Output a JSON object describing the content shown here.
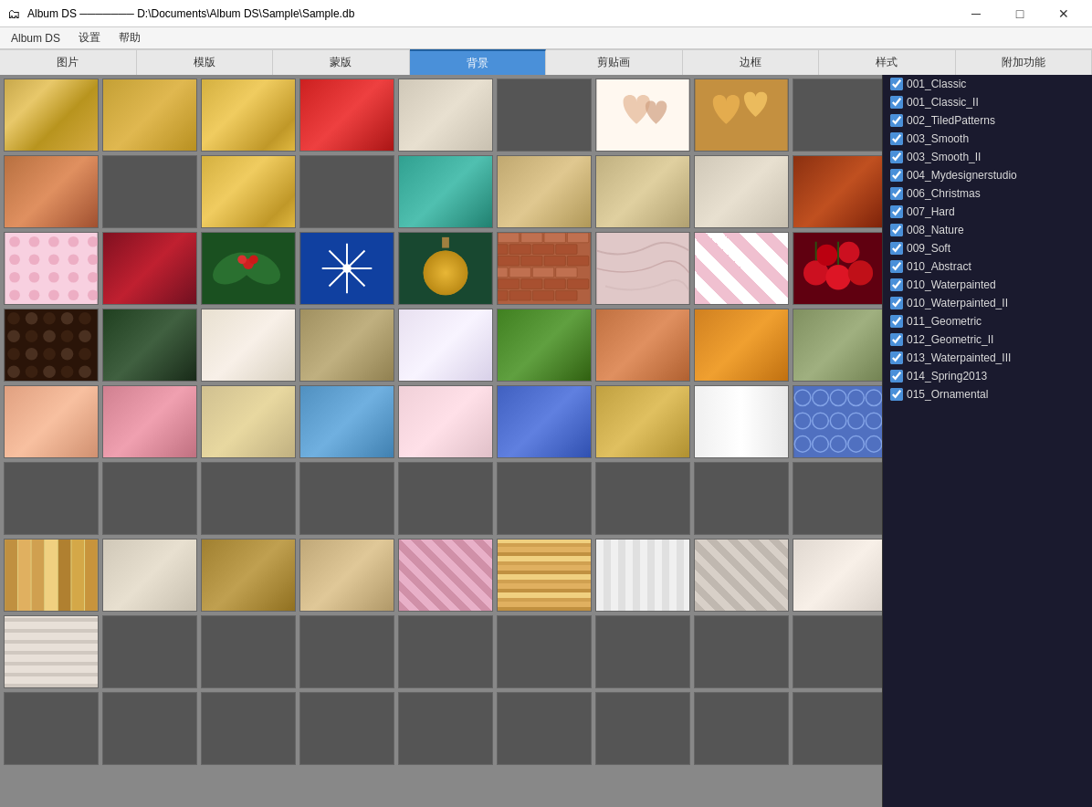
{
  "titleBar": {
    "icon": "📁",
    "title": "Album DS ─────── D:\\Documents\\Album DS\\Sample\\Sample.db",
    "minimizeLabel": "─",
    "maximizeLabel": "□",
    "closeLabel": "✕"
  },
  "menuBar": {
    "items": [
      "Album DS",
      "设置",
      "帮助"
    ]
  },
  "tabs": [
    {
      "label": "图片",
      "active": false
    },
    {
      "label": "模版",
      "active": false
    },
    {
      "label": "蒙版",
      "active": false
    },
    {
      "label": "背景",
      "active": true
    },
    {
      "label": "剪贴画",
      "active": false
    },
    {
      "label": "边框",
      "active": false
    },
    {
      "label": "样式",
      "active": false
    },
    {
      "label": "附加功能",
      "active": false
    }
  ],
  "sidebar": {
    "items": [
      {
        "id": "001_Classic",
        "label": "001_Classic",
        "checked": true
      },
      {
        "id": "001_Classic_II",
        "label": "001_Classic_II",
        "checked": true
      },
      {
        "id": "002_TiledPatterns",
        "label": "002_TiledPatterns",
        "checked": true
      },
      {
        "id": "003_Smooth",
        "label": "003_Smooth",
        "checked": true
      },
      {
        "id": "003_Smooth_II",
        "label": "003_Smooth_II",
        "checked": true
      },
      {
        "id": "004_Mydesignerstudio",
        "label": "004_Mydesignerstudio",
        "checked": true
      },
      {
        "id": "006_Christmas",
        "label": "006_Christmas",
        "checked": true
      },
      {
        "id": "007_Hard",
        "label": "007_Hard",
        "checked": true
      },
      {
        "id": "008_Nature",
        "label": "008_Nature",
        "checked": true
      },
      {
        "id": "009_Soft",
        "label": "009_Soft",
        "checked": true
      },
      {
        "id": "010_Abstract",
        "label": "010_Abstract",
        "checked": true
      },
      {
        "id": "010_Waterpainted",
        "label": "010_Waterpainted",
        "checked": true
      },
      {
        "id": "010_Waterpainted_II",
        "label": "010_Waterpainted_II",
        "checked": true
      },
      {
        "id": "011_Geometric",
        "label": "011_Geometric",
        "checked": true
      },
      {
        "id": "012_Geometric_II",
        "label": "012_Geometric_II",
        "checked": true
      },
      {
        "id": "013_Waterpainted_III",
        "label": "013_Waterpainted_III",
        "checked": true
      },
      {
        "id": "014_Spring2013",
        "label": "014_Spring2013",
        "checked": true
      },
      {
        "id": "015_Ornamental",
        "label": "015_Ornamental",
        "checked": true
      }
    ]
  },
  "thumbnails": [
    {
      "class": "tex-gold",
      "row": 1,
      "col": 1
    },
    {
      "class": "tex-gold2",
      "row": 1,
      "col": 2
    },
    {
      "class": "tex-gold3",
      "row": 1,
      "col": 3
    },
    {
      "class": "tex-red",
      "row": 1,
      "col": 4
    },
    {
      "class": "tex-gray-light",
      "row": 1,
      "col": 5
    },
    {
      "class": "",
      "row": 1,
      "col": 6
    },
    {
      "class": "tex-hearts",
      "row": 1,
      "col": 7
    },
    {
      "class": "tex-hearts-dark",
      "row": 1,
      "col": 8
    },
    {
      "class": "",
      "row": 1,
      "col": 9
    },
    {
      "class": "tex-copper",
      "row": 2,
      "col": 1
    },
    {
      "class": "",
      "row": 2,
      "col": 2
    },
    {
      "class": "tex-gold3",
      "row": 2,
      "col": 3
    },
    {
      "class": "",
      "row": 2,
      "col": 4
    },
    {
      "class": "tex-teal",
      "row": 2,
      "col": 5
    },
    {
      "class": "tex-tan",
      "row": 2,
      "col": 6
    },
    {
      "class": "tex-antique",
      "row": 2,
      "col": 7
    },
    {
      "class": "tex-gray-light",
      "row": 2,
      "col": 8
    },
    {
      "class": "tex-dark-rust",
      "row": 2,
      "col": 9
    },
    {
      "class": "tex-pink-dots",
      "row": 3,
      "col": 1
    },
    {
      "class": "tex-dark-floral",
      "row": 3,
      "col": 2
    },
    {
      "class": "tex-holly",
      "row": 3,
      "col": 3
    },
    {
      "class": "tex-snowflake",
      "row": 3,
      "col": 4
    },
    {
      "class": "tex-ornament",
      "row": 3,
      "col": 5
    },
    {
      "class": "tex-brick",
      "row": 3,
      "col": 6
    },
    {
      "class": "tex-marble",
      "row": 3,
      "col": 7
    },
    {
      "class": "tex-pink-check",
      "row": 3,
      "col": 8
    },
    {
      "class": "tex-cherry",
      "row": 3,
      "col": 9
    },
    {
      "class": "tex-coffee",
      "row": 4,
      "col": 1
    },
    {
      "class": "tex-green-leaf",
      "row": 4,
      "col": 2
    },
    {
      "class": "tex-white-thread",
      "row": 4,
      "col": 3
    },
    {
      "class": "tex-burlap",
      "row": 4,
      "col": 4
    },
    {
      "class": "tex-satin",
      "row": 4,
      "col": 5
    },
    {
      "class": "tex-grass",
      "row": 4,
      "col": 6
    },
    {
      "class": "tex-brown-texture",
      "row": 4,
      "col": 7
    },
    {
      "class": "tex-orange",
      "row": 4,
      "col": 8
    },
    {
      "class": "tex-sage",
      "row": 4,
      "col": 9
    },
    {
      "class": "tex-peach",
      "row": 5,
      "col": 1
    },
    {
      "class": "tex-rose",
      "row": 5,
      "col": 2
    },
    {
      "class": "tex-antique2",
      "row": 5,
      "col": 3
    },
    {
      "class": "tex-blue-crinkle",
      "row": 5,
      "col": 4
    },
    {
      "class": "tex-light-pink",
      "row": 5,
      "col": 5
    },
    {
      "class": "tex-blue-circles",
      "row": 5,
      "col": 6
    },
    {
      "class": "tex-gold-rough",
      "row": 5,
      "col": 7
    },
    {
      "class": "tex-white-stripe",
      "row": 5,
      "col": 8
    },
    {
      "class": "tex-pink-pattern",
      "row": 5,
      "col": 9
    },
    {
      "class": "",
      "row": 6,
      "col": 1
    },
    {
      "class": "",
      "row": 6,
      "col": 2
    },
    {
      "class": "",
      "row": 6,
      "col": 3
    },
    {
      "class": "",
      "row": 6,
      "col": 4
    },
    {
      "class": "",
      "row": 6,
      "col": 5
    },
    {
      "class": "",
      "row": 6,
      "col": 6
    },
    {
      "class": "",
      "row": 6,
      "col": 7
    },
    {
      "class": "",
      "row": 6,
      "col": 8
    },
    {
      "class": "",
      "row": 6,
      "col": 9
    },
    {
      "class": "tex-teal2",
      "row": 7,
      "col": 1
    },
    {
      "class": "tex-gray-light",
      "row": 7,
      "col": 2
    },
    {
      "class": "tex-gold-floral",
      "row": 7,
      "col": 3
    },
    {
      "class": "tex-tan-floral",
      "row": 7,
      "col": 4
    },
    {
      "class": "tex-pink-geo",
      "row": 7,
      "col": 5
    },
    {
      "class": "tex-stripes",
      "row": 7,
      "col": 6
    },
    {
      "class": "tex-white-geo",
      "row": 7,
      "col": 7
    },
    {
      "class": "tex-gray-geo",
      "row": 7,
      "col": 8
    },
    {
      "class": "tex-white2",
      "row": 7,
      "col": 9
    },
    {
      "class": "tex-lace",
      "row": 8,
      "col": 1
    },
    {
      "class": "",
      "row": 8,
      "col": 2
    },
    {
      "class": "",
      "row": 8,
      "col": 3
    },
    {
      "class": "",
      "row": 8,
      "col": 4
    },
    {
      "class": "",
      "row": 8,
      "col": 5
    },
    {
      "class": "",
      "row": 8,
      "col": 6
    },
    {
      "class": "",
      "row": 8,
      "col": 7
    },
    {
      "class": "",
      "row": 8,
      "col": 8
    },
    {
      "class": "",
      "row": 8,
      "col": 9
    },
    {
      "class": "",
      "row": 9,
      "col": 1
    },
    {
      "class": "",
      "row": 9,
      "col": 2
    },
    {
      "class": "",
      "row": 9,
      "col": 3
    },
    {
      "class": "",
      "row": 9,
      "col": 4
    },
    {
      "class": "",
      "row": 9,
      "col": 5
    },
    {
      "class": "",
      "row": 9,
      "col": 6
    },
    {
      "class": "",
      "row": 9,
      "col": 7
    },
    {
      "class": "",
      "row": 9,
      "col": 8
    },
    {
      "class": "",
      "row": 9,
      "col": 9
    }
  ]
}
